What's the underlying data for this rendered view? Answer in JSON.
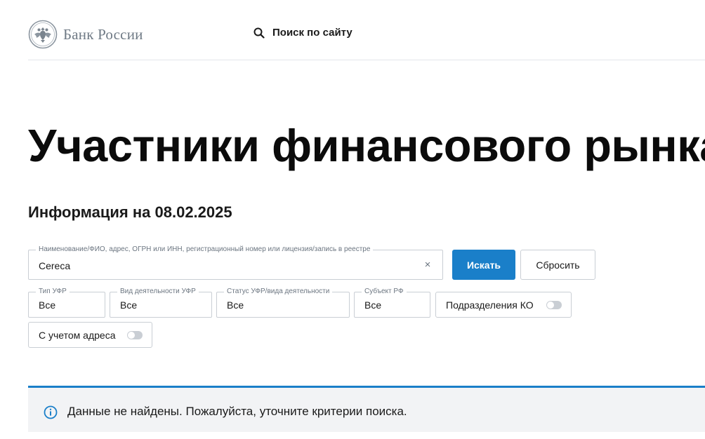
{
  "header": {
    "logo_text": "Банк России",
    "site_search_label": "Поиск по сайту",
    "logo_icon": "double-headed-eagle-icon",
    "search_icon": "search-icon"
  },
  "page": {
    "title": "Участники финансового рынка",
    "info_date": "Информация на 08.02.2025"
  },
  "search": {
    "label": "Наименование/ФИО, адрес, ОГРН или ИНН, регистрационный номер или лицензия/запись в реестре",
    "value": "Cereca",
    "clear_glyph": "×",
    "submit_label": "Искать",
    "reset_label": "Сбросить"
  },
  "filters": {
    "ufr_type": {
      "label": "Тип УФР",
      "value": "Все"
    },
    "activity_type": {
      "label": "Вид деятельности УФР",
      "value": "Все"
    },
    "status": {
      "label": "Статус УФР/вида деятельности",
      "value": "Все"
    },
    "region": {
      "label": "Субъект РФ",
      "value": "Все"
    }
  },
  "toggles": {
    "ko_divisions": {
      "label": "Подразделения КО",
      "on": false
    },
    "with_address": {
      "label": "С учетом адреса",
      "on": false
    }
  },
  "notice": {
    "text": "Данные не найдены. Пожалуйста, уточните критерии поиска.",
    "icon": "info-icon"
  },
  "colors": {
    "accent": "#1a7fc9",
    "logo_gray": "#6f7a85",
    "border": "#c9ced4",
    "notice_bg": "#f2f3f5"
  }
}
